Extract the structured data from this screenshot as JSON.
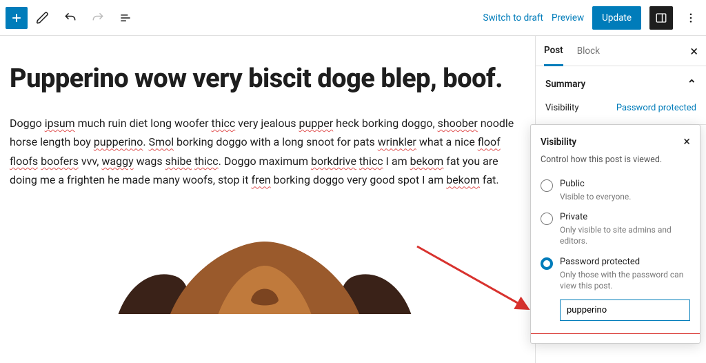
{
  "toolbar": {
    "switch_to_draft": "Switch to draft",
    "preview": "Preview",
    "update": "Update"
  },
  "document": {
    "title": "Pupperino wow very biscit doge blep, boof.",
    "body_html": "Doggo <u>ipsum</u> much ruin diet long woofer <u>thicc</u> very jealous <u>pupper</u> heck borking doggo, <u>shoober</u> noodle horse length boy <u>pupperino</u>. <u>Smol</u> borking doggo with a long snoot for pats <u>wrinkler</u> what a nice <u>floof</u> <u>floofs</u> <u>boofers</u> vvv, <u>waggy</u> wags <u>shibe</u> <u>thicc</u>. Doggo maximum <u>borkdrive</u> <u>thicc</u> I am <u>bekom</u> fat you are doing me a frighten he made many woofs, stop it <u>fren</u> borking doggo very good spot I am <u>bekom</u> fat."
  },
  "sidebar": {
    "tabs": {
      "post": "Post",
      "block": "Block"
    },
    "summary": {
      "heading": "Summary",
      "visibility_label": "Visibility",
      "visibility_value": "Password protected"
    }
  },
  "visibility_popover": {
    "heading": "Visibility",
    "subtitle": "Control how this post is viewed.",
    "options": [
      {
        "id": "public",
        "label": "Public",
        "desc": "Visible to everyone.",
        "checked": false
      },
      {
        "id": "private",
        "label": "Private",
        "desc": "Only visible to site admins and editors.",
        "checked": false
      },
      {
        "id": "password",
        "label": "Password protected",
        "desc": "Only those with the password can view this post.",
        "checked": true
      }
    ],
    "password_value": "pupperino"
  },
  "colors": {
    "accent": "#007cba",
    "danger": "#d8322e"
  }
}
